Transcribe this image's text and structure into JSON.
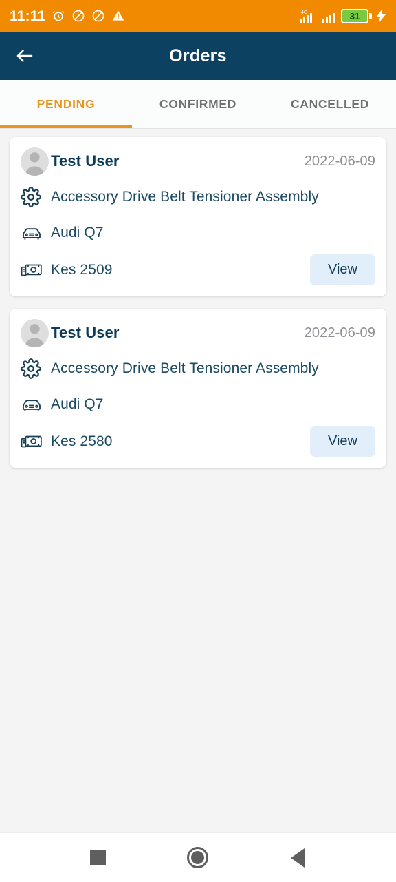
{
  "status_bar": {
    "time": "11:11",
    "left_icons": [
      "alarm-icon",
      "mute-icon",
      "do-not-disturb-icon",
      "warning-icon"
    ],
    "network_label": "4G",
    "signal_icons": [
      "signal-bars-sim1-icon",
      "signal-bars-sim2-icon"
    ],
    "battery_level": "31",
    "charging": true,
    "background_color": "#f28a00"
  },
  "app_bar": {
    "title": "Orders",
    "back_icon": "arrow-left-icon",
    "background_color": "#0d4161"
  },
  "tabs": {
    "active_index": 0,
    "accent_color": "#e8961e",
    "items": [
      {
        "label": "PENDING"
      },
      {
        "label": "CONFIRMED"
      },
      {
        "label": "CANCELLED"
      }
    ]
  },
  "orders": [
    {
      "user": "Test User",
      "date": "2022-06-09",
      "part": "Accessory Drive Belt Tensioner Assembly",
      "vehicle": "Audi Q7",
      "price": "Kes 2509",
      "action_label": "View"
    },
    {
      "user": "Test User",
      "date": "2022-06-09",
      "part": "Accessory Drive Belt Tensioner Assembly",
      "vehicle": "Audi Q7",
      "price": "Kes 2580",
      "action_label": "View"
    }
  ],
  "nav_bar": {
    "recents_icon": "square-recents-icon",
    "home_icon": "circle-home-icon",
    "back_icon": "triangle-back-icon"
  }
}
